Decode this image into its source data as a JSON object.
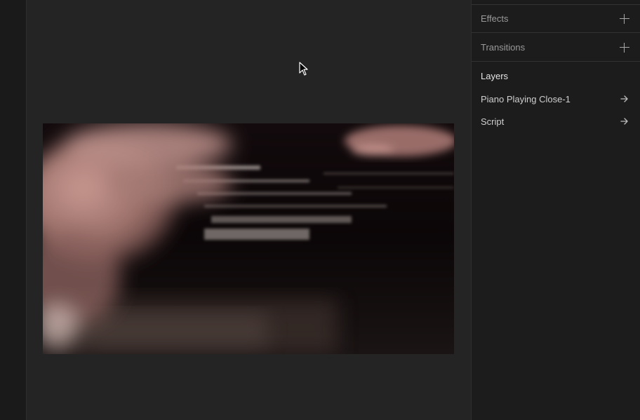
{
  "panel": {
    "effects_label": "Effects",
    "transitions_label": "Transitions",
    "layers_title": "Layers",
    "layers": [
      {
        "label": "Piano Playing Close-1",
        "icon": "arrow-right-icon"
      },
      {
        "label": "Script",
        "icon": "arrow-right-icon"
      }
    ]
  },
  "icons": {
    "add": "plus-icon",
    "navigate": "arrow-right-icon",
    "pointer": "cursor-icon"
  },
  "colors": {
    "canvas_bg": "#242424",
    "panel_bg": "#1c1c1c",
    "rail_bg": "#1a1a1a",
    "divider": "#333333",
    "label_dim": "#9a9a9a",
    "label_bright": "#e6e6e6"
  }
}
